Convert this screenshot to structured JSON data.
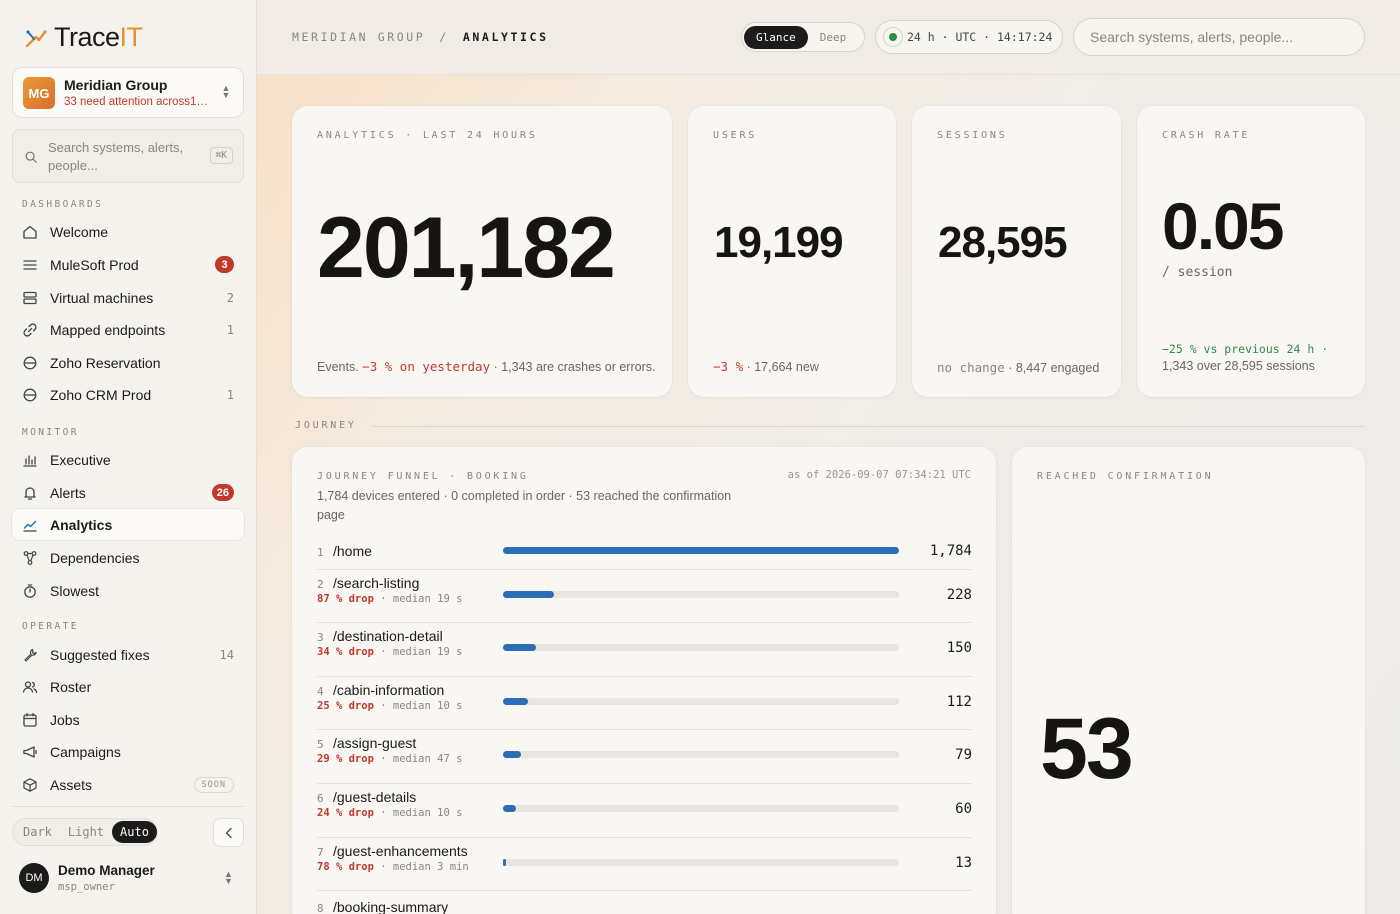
{
  "app": {
    "logo_prefix": "Trace",
    "logo_suffix": "IT"
  },
  "org": {
    "initials": "MG",
    "name": "Meridian Group",
    "subtitle": "33 need attention across1 ..."
  },
  "sidebar_search": {
    "placeholder": "Search systems, alerts, people...",
    "shortcut": "⌘K"
  },
  "sections": {
    "dashboards": "DASHBOARDS",
    "monitor": "MONITOR",
    "operate": "OPERATE"
  },
  "nav": {
    "welcome": {
      "label": "Welcome"
    },
    "mulesoft": {
      "label": "MuleSoft Prod",
      "badge": "3"
    },
    "vms": {
      "label": "Virtual machines",
      "count": "2"
    },
    "endpoints": {
      "label": "Mapped endpoints",
      "count": "1"
    },
    "zoho_res": {
      "label": "Zoho Reservation"
    },
    "zoho_crm": {
      "label": "Zoho CRM Prod",
      "count": "1"
    },
    "executive": {
      "label": "Executive"
    },
    "alerts": {
      "label": "Alerts",
      "badge": "26"
    },
    "analytics": {
      "label": "Analytics"
    },
    "dependencies": {
      "label": "Dependencies"
    },
    "slowest": {
      "label": "Slowest"
    },
    "fixes": {
      "label": "Suggested fixes",
      "count": "14"
    },
    "roster": {
      "label": "Roster"
    },
    "jobs": {
      "label": "Jobs"
    },
    "campaigns": {
      "label": "Campaigns"
    },
    "assets": {
      "label": "Assets",
      "tag": "SOON"
    }
  },
  "theme": {
    "dark": "Dark",
    "light": "Light",
    "auto": "Auto",
    "selected": "Auto"
  },
  "user": {
    "initials": "DM",
    "name": "Demo Manager",
    "role": "msp_owner"
  },
  "breadcrumb": {
    "parent": "MERIDIAN GROUP",
    "separator": "/",
    "current": "ANALYTICS"
  },
  "view_toggle": {
    "glance": "Glance",
    "deep": "Deep",
    "selected": "Glance"
  },
  "time": {
    "text": "24 h · UTC · 14:17:24",
    "status_color": "#2e8b4a"
  },
  "top_search": {
    "placeholder": "Search systems, alerts, people..."
  },
  "cards": {
    "events": {
      "kicker": "ANALYTICS · LAST 24 HOURS",
      "value": "201,182",
      "foot_prefix": "Events.",
      "delta": "−3 % on yesterday",
      "foot_suffix": "· 1,343 are crashes or errors."
    },
    "users": {
      "kicker": "USERS",
      "value": "19,199",
      "delta": "−3 %",
      "foot_suffix": "· 17,664 new"
    },
    "sessions": {
      "kicker": "SESSIONS",
      "value": "28,595",
      "delta": "no change",
      "foot_suffix": "· 8,447 engaged"
    },
    "crash": {
      "kicker": "CRASH RATE",
      "value": "0.05",
      "unit": "/ session",
      "delta": "−25 % vs previous 24 h ·",
      "foot": "1,343 over 28,595 sessions"
    }
  },
  "journey": {
    "label": "JOURNEY",
    "funnel": {
      "kicker": "JOURNEY FUNNEL · BOOKING",
      "as_of": "as of 2026-09-07 07:34:21 UTC",
      "description": "1,784 devices entered · 0 completed in order · 53 reached the confirmation page",
      "max": 1784,
      "steps": [
        {
          "idx": "1",
          "path": "/home",
          "value": "1,784",
          "n": 1784
        },
        {
          "idx": "2",
          "path": "/search-listing",
          "drop": "87 % drop",
          "median": "· median 19 s",
          "value": "228",
          "n": 228
        },
        {
          "idx": "3",
          "path": "/destination-detail",
          "drop": "34 % drop",
          "median": "· median 19 s",
          "value": "150",
          "n": 150
        },
        {
          "idx": "4",
          "path": "/cabin-information",
          "drop": "25 % drop",
          "median": "· median 10 s",
          "value": "112",
          "n": 112
        },
        {
          "idx": "5",
          "path": "/assign-guest",
          "drop": "29 % drop",
          "median": "· median 47 s",
          "value": "79",
          "n": 79
        },
        {
          "idx": "6",
          "path": "/guest-details",
          "drop": "24 % drop",
          "median": "· median 10 s",
          "value": "60",
          "n": 60
        },
        {
          "idx": "7",
          "path": "/guest-enhancements",
          "drop": "78 % drop",
          "median": "· median 3 min",
          "value": "13",
          "n": 13
        },
        {
          "idx": "8",
          "path": "/booking-summary",
          "value": "",
          "n": 0
        }
      ]
    },
    "confirmation": {
      "kicker": "REACHED CONFIRMATION",
      "value": "53"
    }
  },
  "colors": {
    "accent": "#e8902e",
    "bar": "#2a6fb5",
    "negative": "#c0392b",
    "positive": "#2e8b4a"
  }
}
